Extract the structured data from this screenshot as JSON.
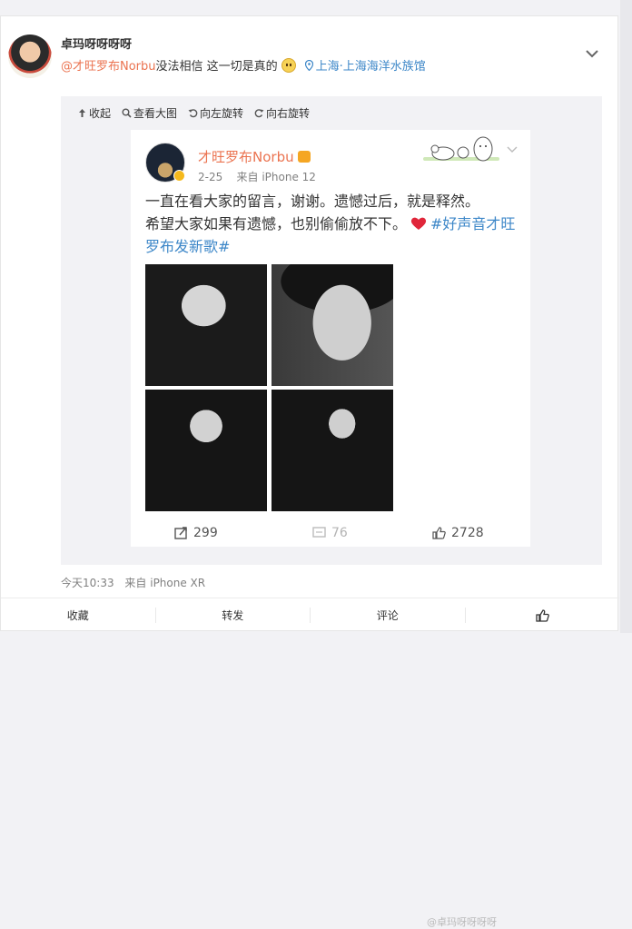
{
  "post": {
    "username": "卓玛呀呀呀呀",
    "mention": "@才旺罗布Norbu",
    "caption": " 没法相信 这一切是真的",
    "location": "上海·上海海洋水族馆",
    "timestamp": "今天10:33",
    "source": "来自 iPhone XR"
  },
  "toolbar": {
    "collapse": "收起",
    "view_large": "查看大图",
    "rotate_left": "向左旋转",
    "rotate_right": "向右旋转"
  },
  "embedded": {
    "name": "才旺罗布Norbu",
    "date": "2-25",
    "source": "来自 iPhone 12",
    "text_line1": "一直在看大家的留言，谢谢。遗憾过后，就是释然。",
    "text_line2": "希望大家如果有遗憾，也别偷偷放不下。",
    "hashtag": "#好声音才旺罗布发新歌#",
    "reposts": "299",
    "comments": "76",
    "likes": "2728",
    "watermark": "@卓玛呀呀呀呀"
  },
  "actions": {
    "favorite": "收藏",
    "repost": "转发",
    "comment": "评论"
  },
  "colors": {
    "link": "#3d87c8",
    "mention": "#eb7350",
    "background": "#f2f2f5"
  }
}
